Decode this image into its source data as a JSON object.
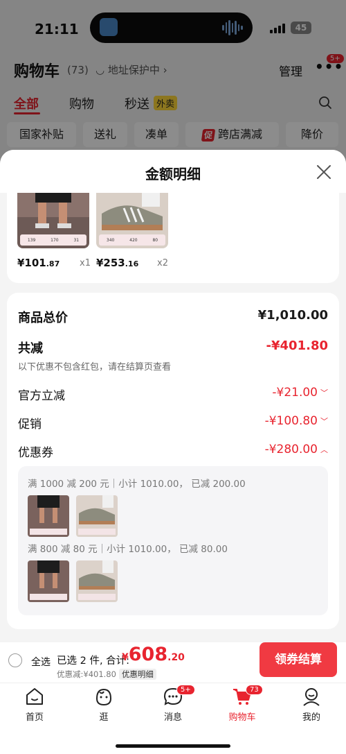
{
  "status": {
    "time": "21:11",
    "battery": "45"
  },
  "cart_header": {
    "title": "购物车",
    "count": "(73)",
    "address_protect": "◡ 地址保护中 ›",
    "manage": "管理",
    "more_badge": "5+"
  },
  "tabs": {
    "all": "全部",
    "shopping": "购物",
    "delivery": "秒送",
    "waimai": "外卖"
  },
  "chips": {
    "national_subsidy": "国家补贴",
    "gift": "送礼",
    "make_up_order": "凑单",
    "promo_tag": "促",
    "cross_store": "跨店满减",
    "price_drop": "降价"
  },
  "sheet": {
    "title": "金额明细"
  },
  "items": [
    {
      "price_int": "¥101",
      "price_dec": ".87",
      "qty": "x1",
      "strip": [
        "139",
        "170",
        "31"
      ]
    },
    {
      "price_int": "¥253",
      "price_dec": ".16",
      "qty": "x2",
      "strip": [
        "340",
        "420",
        "80"
      ]
    }
  ],
  "details": {
    "goods_total_label": "商品总价",
    "goods_total_value": "¥1,010.00",
    "total_discount_label": "共减",
    "total_discount_value": "-¥401.80",
    "note": "以下优惠不包含红包，请在结算页查看",
    "official_label": "官方立减",
    "official_value": "-¥21.00",
    "promo_label": "促销",
    "promo_value": "-¥100.80",
    "coupon_label": "优惠券",
    "coupon_value": "-¥280.00"
  },
  "coupon_rules": [
    {
      "text": "满 1000 减 200 元｜小计 1010.00， 已减 200.00"
    },
    {
      "text": "满 800 减 80 元｜小计 1010.00， 已减 80.00"
    }
  ],
  "checkout": {
    "select_all": "全选",
    "selected": "已选 2 件, 合计:",
    "yen": "¥",
    "total_int": "608",
    "total_dec": ".20",
    "discount": "优惠减:¥401.80",
    "detail_link": "优惠明细",
    "button": "领券结算"
  },
  "nav": {
    "home": "首页",
    "browse": "逛",
    "messages": "消息",
    "messages_badge": "5+",
    "cart": "购物车",
    "cart_badge": "73",
    "me": "我的"
  },
  "colors": {
    "accent": "#e8242f",
    "button": "#f03a42"
  }
}
